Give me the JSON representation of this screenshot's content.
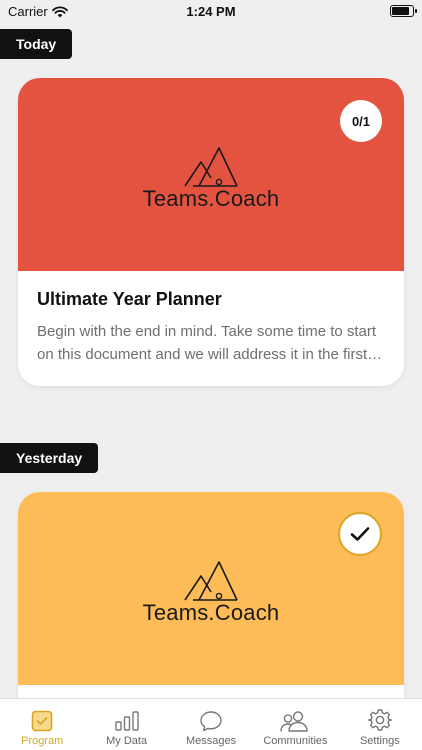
{
  "status": {
    "carrier": "Carrier",
    "time": "1:24 PM",
    "battery_level": 0.9
  },
  "sections": [
    {
      "label": "Today",
      "card": {
        "color": "#e35340",
        "logo_text": "Teams.Coach",
        "badge": "0/1",
        "title": "Ultimate Year Planner",
        "description": "Begin with the end in mind. Take some time to start on this document and we will address it in the first session."
      }
    },
    {
      "label": "Yesterday",
      "card": {
        "color": "#fdbc58",
        "logo_text": "Teams.Coach",
        "badge_icon": "checkmark-icon",
        "badge_color": "#d9a623"
      }
    }
  ],
  "tabs": [
    {
      "label": "Program",
      "icon": "program-icon",
      "active": true
    },
    {
      "label": "My Data",
      "icon": "bar-chart-icon",
      "active": false
    },
    {
      "label": "Messages",
      "icon": "chat-bubble-icon",
      "active": false
    },
    {
      "label": "Communities",
      "icon": "users-icon",
      "active": false
    },
    {
      "label": "Settings",
      "icon": "gear-icon",
      "active": false
    }
  ],
  "colors": {
    "accent": "#d9a623",
    "pill_bg": "#111111",
    "background": "#efefef"
  }
}
